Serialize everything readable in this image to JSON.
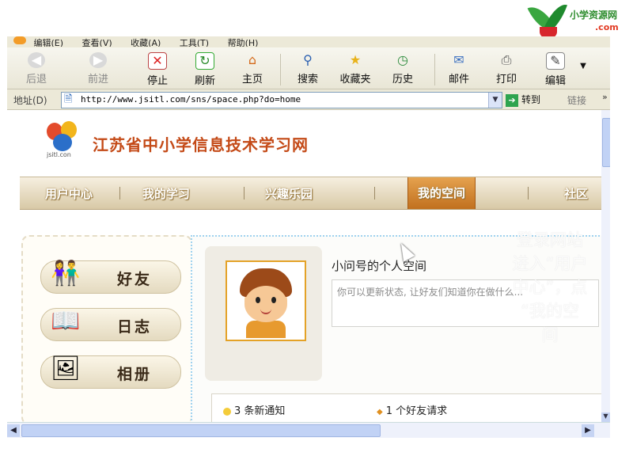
{
  "corner_logo": {
    "text_top": "小学资源网",
    "text_bottom": ".com"
  },
  "menubar": {
    "items": [
      "编辑(E)",
      "查看(V)",
      "收藏(A)",
      "工具(T)",
      "帮助(H)"
    ]
  },
  "toolbar": {
    "back": "后退",
    "forward": "前进",
    "stop": "停止",
    "refresh": "刷新",
    "home": "主页",
    "search": "搜索",
    "favorites": "收藏夹",
    "history": "历史",
    "mail": "邮件",
    "print": "打印",
    "edit": "编辑"
  },
  "addressbar": {
    "label": "地址(D)",
    "url": "http://www.jsitl.com/sns/space.php?do=home",
    "go_label": "转到",
    "links_label": "链接"
  },
  "site": {
    "logo_text": "jsitl.con",
    "title": "江苏省中小学信息技术学习网"
  },
  "nav": {
    "items": [
      "用户中心",
      "我的学习",
      "兴趣乐园",
      "我的空间",
      "社区"
    ],
    "active": "我的空间"
  },
  "sidebar": {
    "items": [
      "好友",
      "日志",
      "相册"
    ]
  },
  "main": {
    "space_title": "小问号的个人空间",
    "status_placeholder": "你可以更新状态, 让好友们知道你在做什么...",
    "notice_1": "3 条新通知",
    "notice_2": "1 个好友请求"
  },
  "overlay": {
    "lines": [
      "登录网站",
      "进入“用户",
      "中心”，点",
      "“我的空",
      "间"
    ]
  }
}
